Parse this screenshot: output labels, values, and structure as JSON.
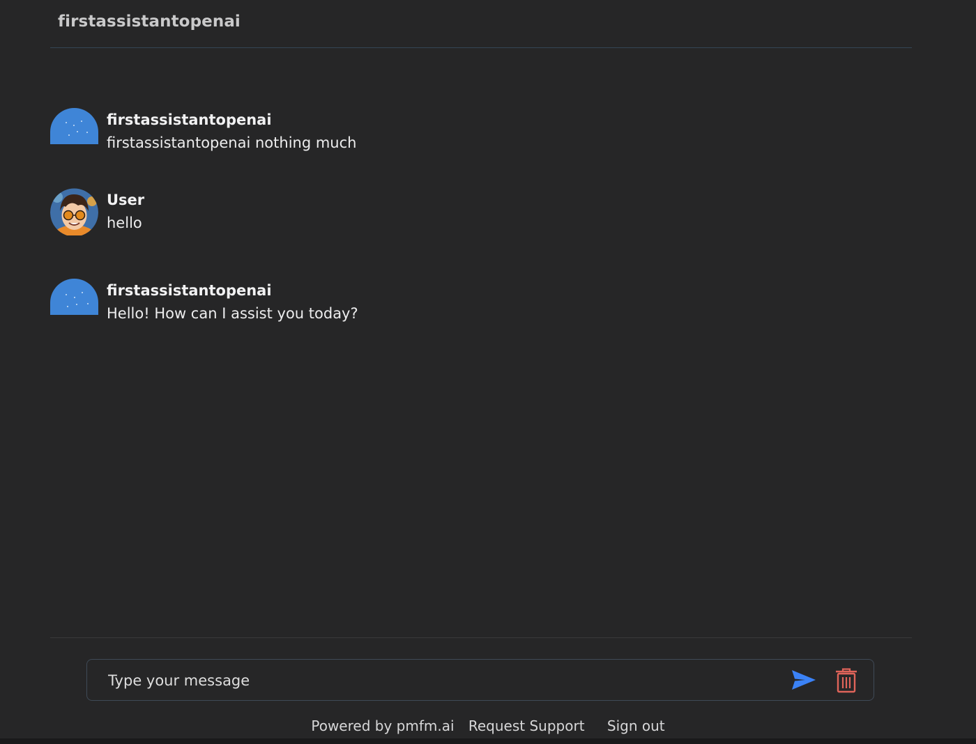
{
  "header": {
    "title": "firstassistantopenai"
  },
  "messages": [
    {
      "author": "firstassistantopenai",
      "text": "firstassistantopenai nothing much",
      "avatar_icon": "bot-avatar-icon",
      "role": "assistant"
    },
    {
      "author": "User",
      "text": "hello",
      "avatar_icon": "user-avatar-icon",
      "role": "user"
    },
    {
      "author": "firstassistantopenai",
      "text": "Hello! How can I assist you today?",
      "avatar_icon": "bot-avatar-icon",
      "role": "assistant"
    }
  ],
  "composer": {
    "placeholder": "Type your message",
    "value": "",
    "send_icon": "send-icon",
    "delete_icon": "trash-icon"
  },
  "footer": {
    "powered_by": "Powered by pmfm.ai",
    "request_support": "Request Support",
    "sign_out": "Sign out"
  },
  "colors": {
    "background": "#262627",
    "accent": "#3f85d7",
    "send": "#3b82f6",
    "delete": "#e0645a"
  }
}
